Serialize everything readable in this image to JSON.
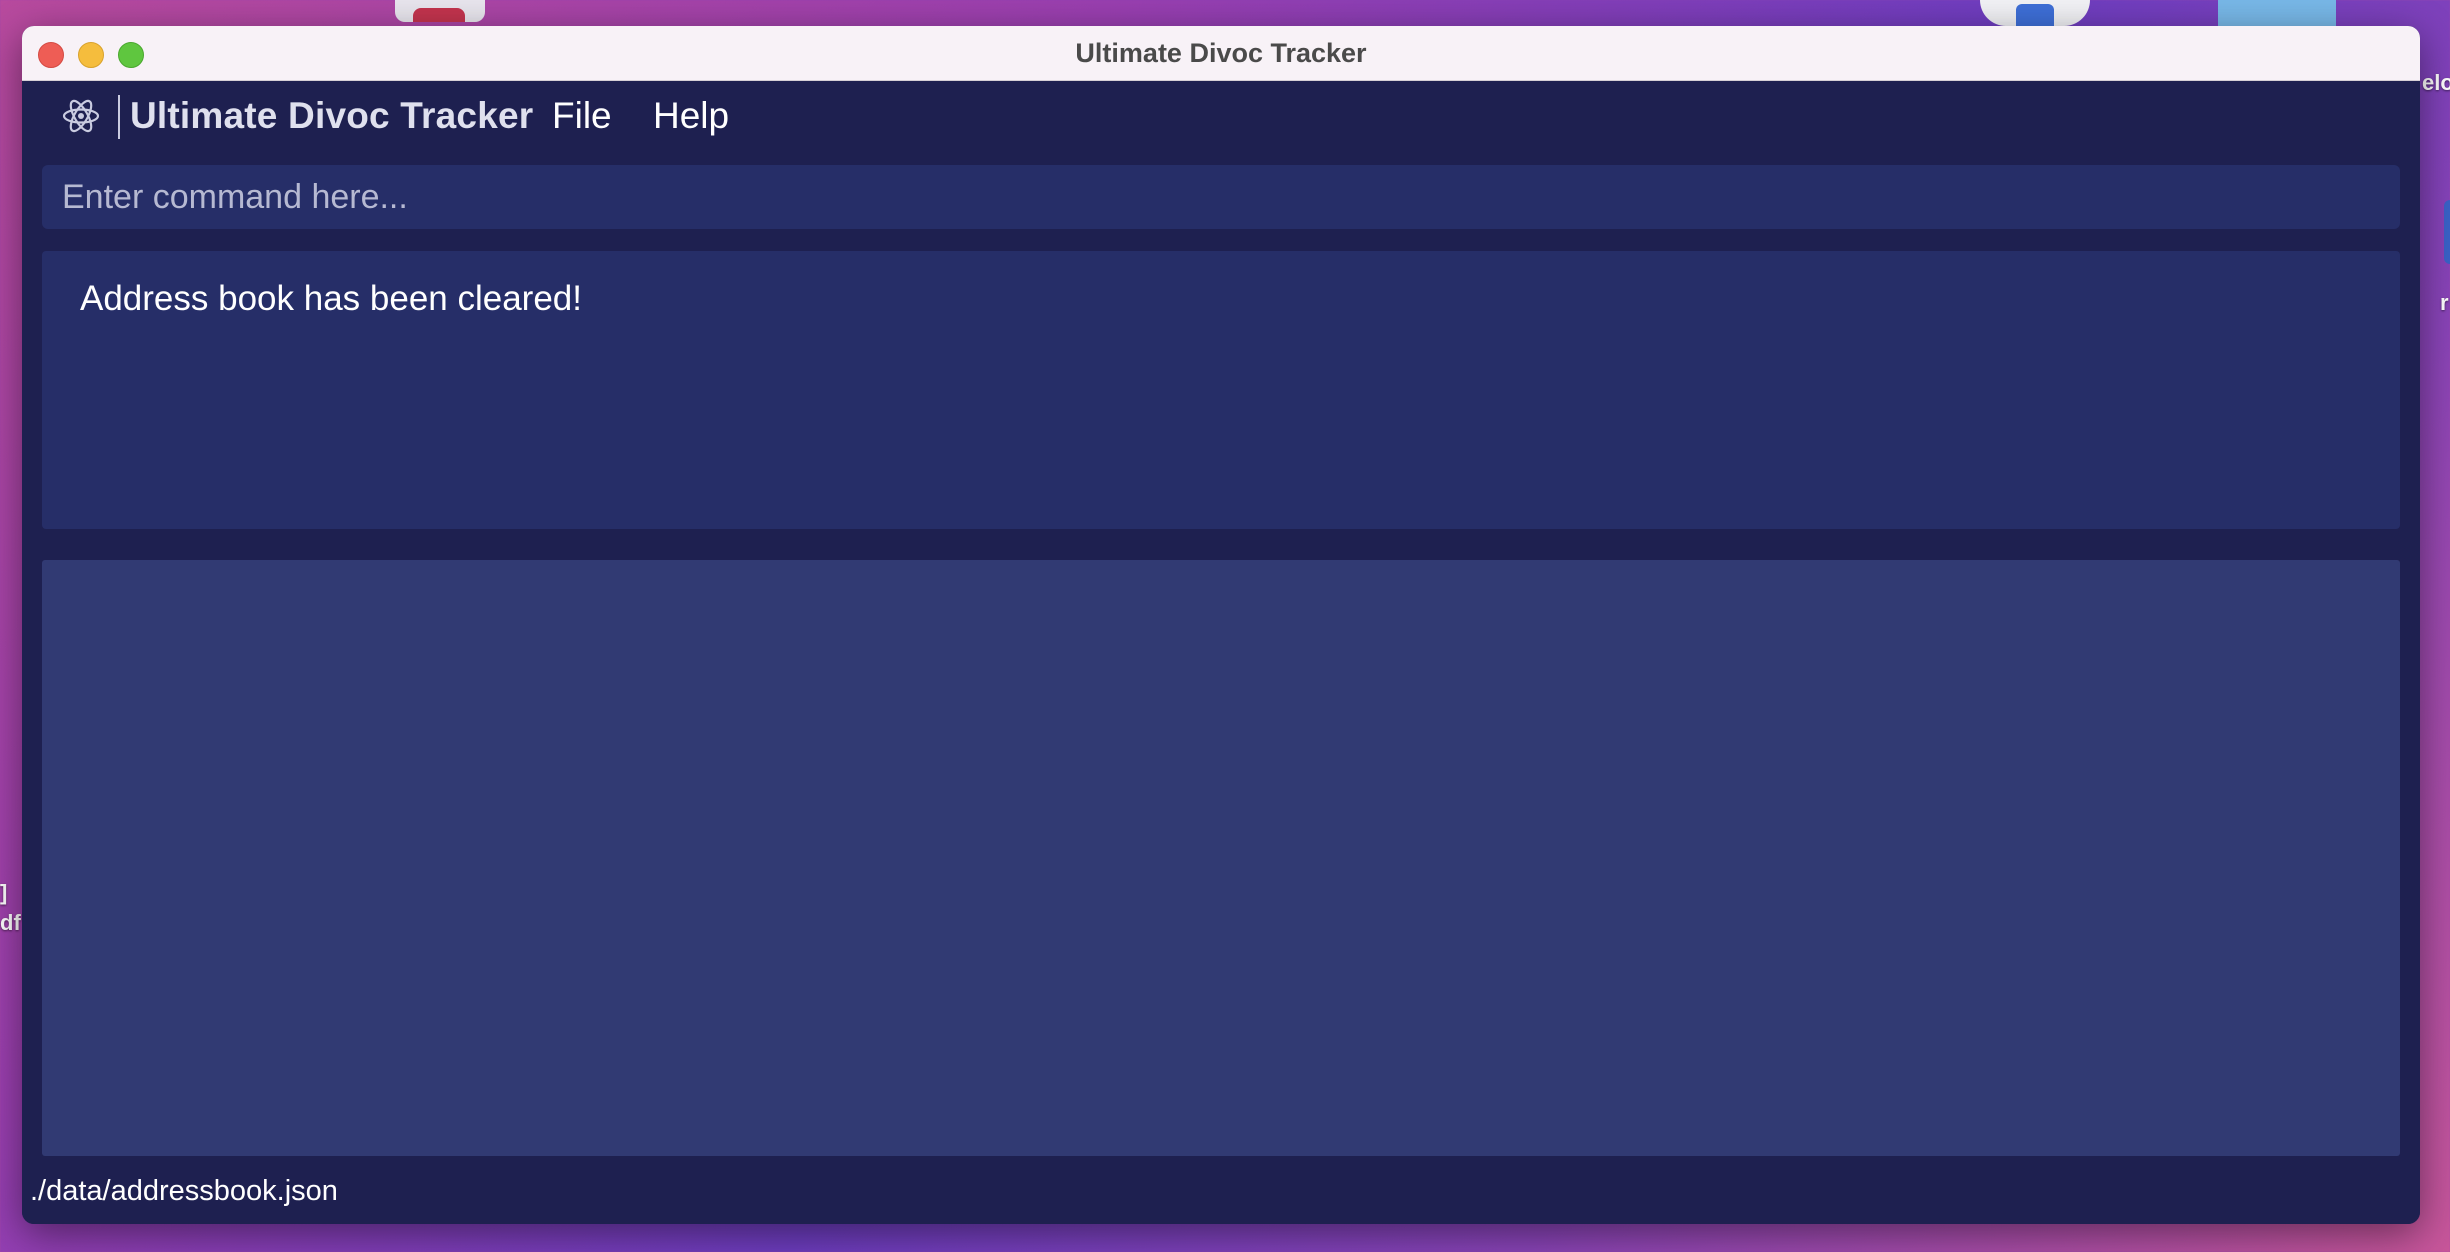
{
  "desktop": {
    "left_text_1": "]",
    "left_text_2": "df",
    "right_text_1": "elo",
    "right_text_2": "r"
  },
  "window": {
    "title": "Ultimate Divoc Tracker"
  },
  "menubar": {
    "logo_text": "Ultimate Divoc Tracker",
    "file_label": "File",
    "help_label": "Help"
  },
  "command": {
    "value": "",
    "placeholder": "Enter command here..."
  },
  "result": {
    "message": "Address book has been cleared!"
  },
  "status": {
    "file_path": "./data/addressbook.json"
  },
  "colors": {
    "app_background": "#1e2050",
    "command_box": "#262e68",
    "result_box": "#262e68",
    "list_panel": "#313a73",
    "titlebar": "#f8f2f7"
  }
}
